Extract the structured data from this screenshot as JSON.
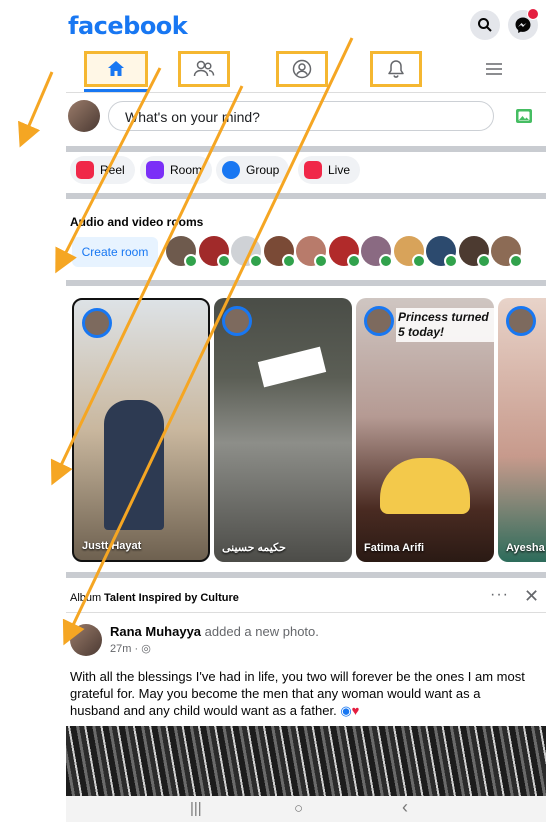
{
  "app": {
    "logo": "facebook"
  },
  "top_actions": [
    {
      "icon": "search-icon"
    },
    {
      "icon": "messenger-icon",
      "badge": true
    }
  ],
  "nav": {
    "tabs": [
      {
        "name": "home",
        "icon": "home-icon",
        "active": true
      },
      {
        "name": "friends",
        "icon": "friends-icon"
      },
      {
        "name": "profile",
        "icon": "profile-icon"
      },
      {
        "name": "notifications",
        "icon": "bell-icon"
      },
      {
        "name": "menu",
        "icon": "menu-icon"
      }
    ]
  },
  "composer": {
    "placeholder": "What's on your mind?"
  },
  "chips": [
    {
      "label": "Reel",
      "color": "#f02849"
    },
    {
      "label": "Room",
      "color": "#7b2ff7"
    },
    {
      "label": "Group",
      "color": "#1877f2"
    },
    {
      "label": "Live",
      "color": "#f02849"
    }
  ],
  "rooms": {
    "title": "Audio and video rooms",
    "create_label": "Create room",
    "avatars": 11
  },
  "stories": [
    {
      "name": "Justt Hayat"
    },
    {
      "name": "حکیمه حسینی"
    },
    {
      "name": "Fatima Arifi",
      "overlay": "Princess turned 5 today!"
    },
    {
      "name": "Ayesha A"
    }
  ],
  "album": {
    "prefix": "Album",
    "title": "Talent Inspired by Culture"
  },
  "post": {
    "author": "Rana Muhayya",
    "action": "added a new photo.",
    "time": "27m ·",
    "text": "With all the blessings I've had in life, you two will forever be the ones I am most grateful for.  May you become the men that any woman would want as a husband and any child would want as a father."
  },
  "system_nav": {
    "recents": "|||",
    "home": "○",
    "back": "‹"
  },
  "colors": {
    "brand": "#1877f2",
    "highlight": "#f5b731",
    "online": "#31a24c"
  }
}
